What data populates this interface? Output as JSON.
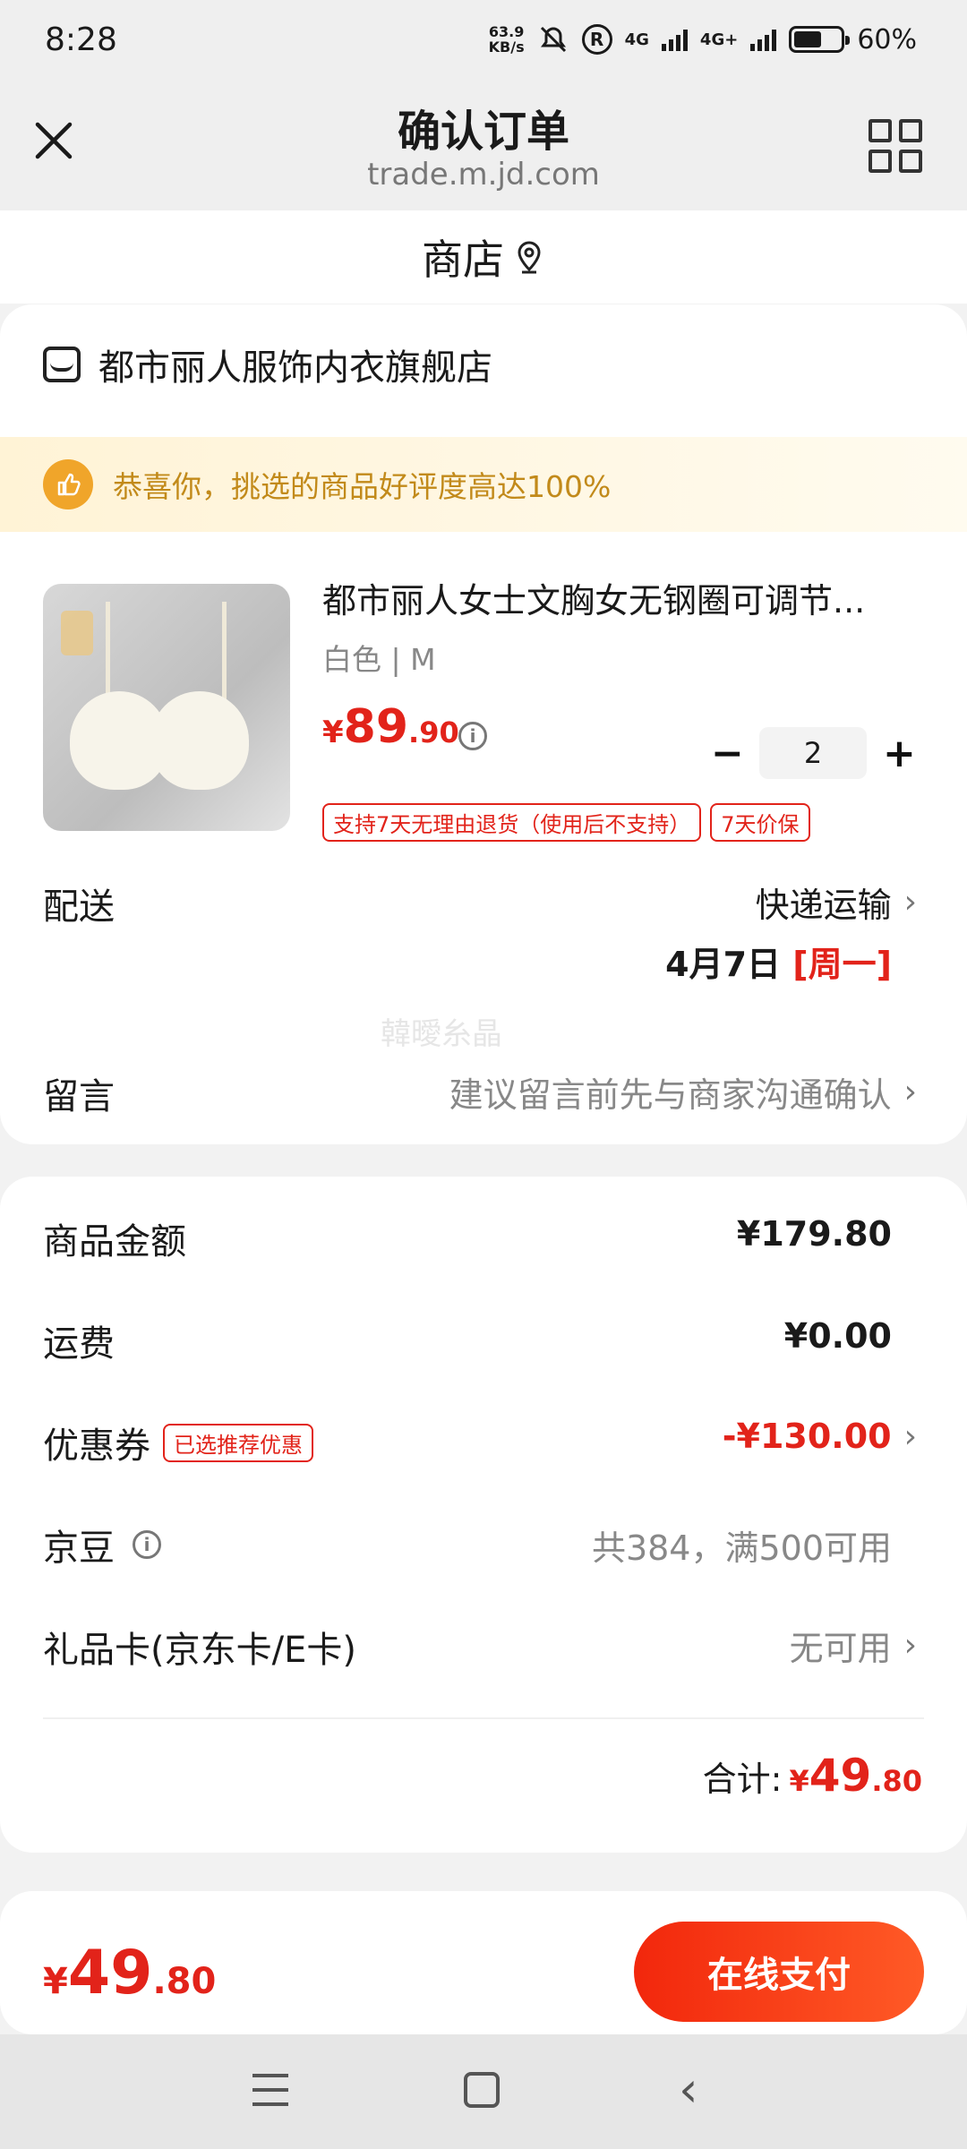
{
  "status_bar": {
    "time": "8:28",
    "speed_top": "63.9",
    "speed_unit": "KB/s",
    "net1": "4G",
    "net2": "4G+",
    "battery": "60%",
    "battery_level": 0.6
  },
  "title_bar": {
    "title": "确认订单",
    "url": "trade.m.jd.com"
  },
  "shop_tab": {
    "label": "商店"
  },
  "store": {
    "name": "都市丽人服饰内衣旗舰店",
    "praise": "恭喜你，挑选的商品好评度高达100%"
  },
  "product": {
    "title": "都市丽人女士文胸女无钢圈可调节...",
    "spec": "白色 | M",
    "price_currency": "¥",
    "price_int": "89",
    "price_dec": ".90",
    "quantity": "2",
    "minus": "−",
    "plus": "+",
    "tags": [
      "支持7天无理由退货（使用后不支持）",
      "7天价保"
    ]
  },
  "delivery": {
    "label": "配送",
    "method": "快递运输",
    "date": "4月7日",
    "weekday": "[周一]"
  },
  "watermark": "韓曖糸晶",
  "message": {
    "label": "留言",
    "placeholder": "建议留言前先与商家沟通确认"
  },
  "summary": {
    "goods_label": "商品金额",
    "goods_value": "¥179.80",
    "shipping_label": "运费",
    "shipping_value": "¥0.00",
    "coupon_label": "优惠券",
    "coupon_tag": "已选推荐优惠",
    "coupon_value": "-¥130.00",
    "jingdou_label": "京豆",
    "jingdou_value": "共384，满500可用",
    "giftcard_label": "礼品卡(京东卡/E卡)",
    "giftcard_value": "无可用",
    "total_label": "合计:",
    "total_currency": "¥",
    "total_int": "49",
    "total_dec": ".80"
  },
  "bottom_bar": {
    "currency": "¥",
    "amount_int": "49",
    "amount_dec": ".80",
    "pay_label": "在线支付"
  },
  "colors": {
    "accent_red": "#e2231a",
    "praise_gold": "#c28a1a",
    "pay_button_start": "#f2270c",
    "pay_button_end": "#ff5a26"
  }
}
